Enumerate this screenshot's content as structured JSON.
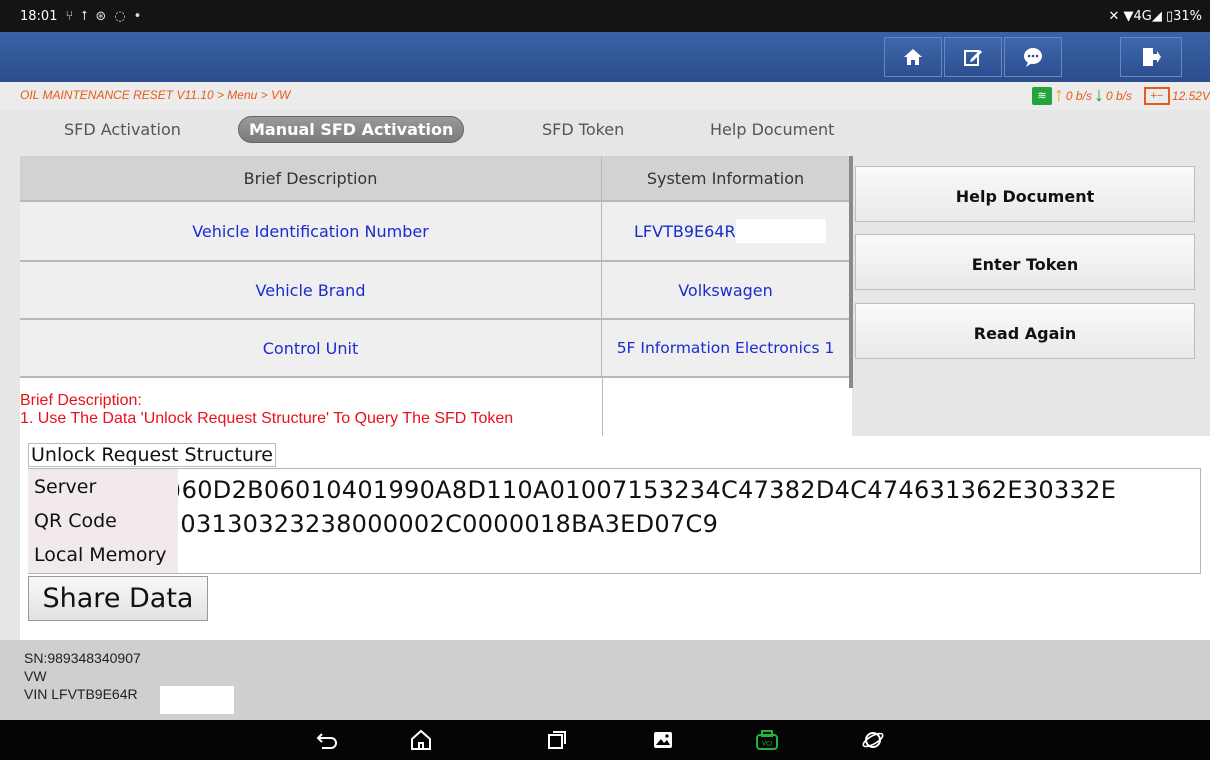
{
  "status_bar": {
    "time": "18:01",
    "left_icons": [
      "usb-icon",
      "upload-icon",
      "settings-icon",
      "chat-icon",
      "dot-icon"
    ],
    "right_text": "✕ ▼4G◢ ▯31%"
  },
  "header_buttons": [
    "home-icon",
    "edit-icon",
    "message-icon",
    "exit-icon"
  ],
  "breadcrumb": "OIL MAINTENANCE RESET V11.10 > Menu > VW",
  "network": {
    "up": "0 b/s",
    "down": "0 b/s",
    "voltage": "12.52V"
  },
  "tabs": [
    {
      "label": "SFD Activation"
    },
    {
      "label": "Manual SFD Activation"
    },
    {
      "label": "SFD Token"
    },
    {
      "label": "Help Document"
    }
  ],
  "table": {
    "headers": [
      "Brief Description",
      "System Information"
    ],
    "rows": [
      {
        "label": "Vehicle Identification Number",
        "value": "LFVTB9E64R"
      },
      {
        "label": "Vehicle Brand",
        "value": "Volkswagen"
      },
      {
        "label": "Control Unit",
        "value": "5F Information Electronics 1"
      }
    ]
  },
  "description": {
    "title": "Brief Description:",
    "line": "1. Use The Data 'Unlock Request Structure' To Query The SFD Token"
  },
  "right_buttons": [
    "Help Document",
    "Enter Token",
    "Read Again"
  ],
  "unlock": {
    "label": "Unlock Request Structure",
    "line1": ")60D2B06010401990A8D110A01007153234C47382D4C474631362E30332E",
    "line2": ";03130323238000002C0000018BA3ED07C9"
  },
  "popup_menu": [
    "Server",
    "QR Code",
    "Local Memory"
  ],
  "share_button": "Share Data",
  "footer": {
    "sn": "SN:989348340907",
    "make": "VW",
    "vin": "VIN LFVTB9E64R"
  }
}
